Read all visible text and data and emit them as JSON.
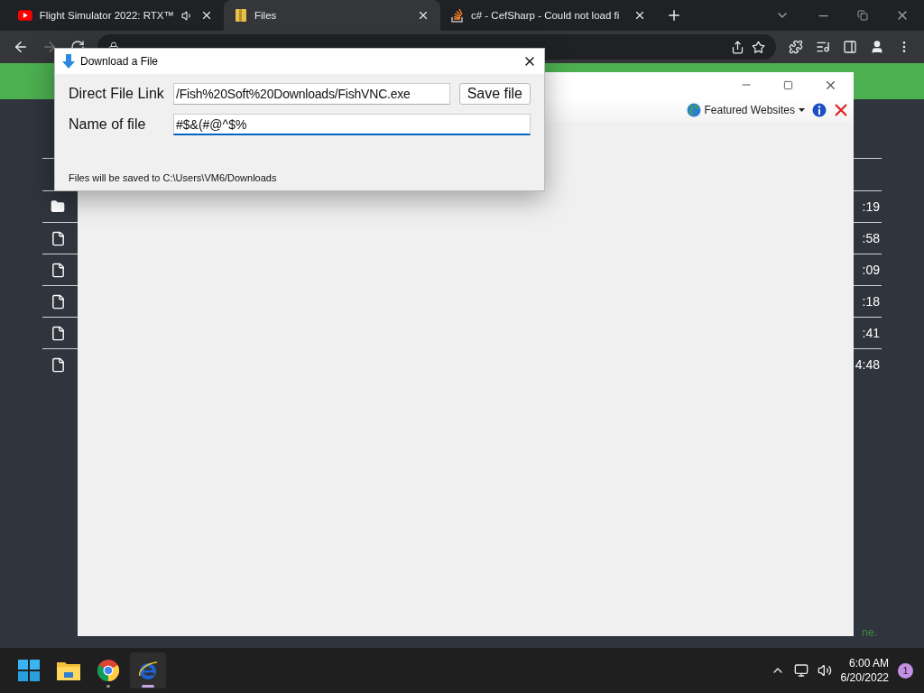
{
  "browser": {
    "tabs": [
      {
        "title": "Flight Simulator 2022: RTX™",
        "kind": "video",
        "audio": true,
        "selected": false
      },
      {
        "title": "Files",
        "kind": "folder",
        "audio": false,
        "selected": true
      },
      {
        "title": "c# - CefSharp - Could not load fi",
        "kind": "stack",
        "audio": false,
        "selected": false
      }
    ],
    "forward_disabled": true,
    "page": {
      "rows": [
        {
          "kind": "folder",
          "time": ":19"
        },
        {
          "kind": "file",
          "time": ":58"
        },
        {
          "kind": "file",
          "time": ":09"
        },
        {
          "kind": "file",
          "time": ":18"
        },
        {
          "kind": "file",
          "time": ":41"
        },
        {
          "kind": "file",
          "time": "4:48"
        }
      ],
      "footer_fragment": "ne."
    }
  },
  "app_window": {
    "toolbar": {
      "menu": "Featured Websites"
    }
  },
  "dialog": {
    "title": "Download a File",
    "fields": [
      {
        "label": "Direct File Link",
        "value": "/Fish%20Soft%20Downloads/FishVNC.exe",
        "focused": false
      },
      {
        "label": "Name of file",
        "value": "#$&(#@^$%",
        "focused": true
      }
    ],
    "save_button": "Save file",
    "note": "Files will be saved to C:\\Users\\VM6/Downloads"
  },
  "taskbar": {
    "apps": [
      {
        "kind": "start",
        "active": false
      },
      {
        "kind": "explorer",
        "active": false
      },
      {
        "kind": "chrome",
        "active": false
      },
      {
        "kind": "ie",
        "active": true
      }
    ],
    "time": "6:00 AM",
    "date": "6/20/2022",
    "notifications": "1"
  }
}
